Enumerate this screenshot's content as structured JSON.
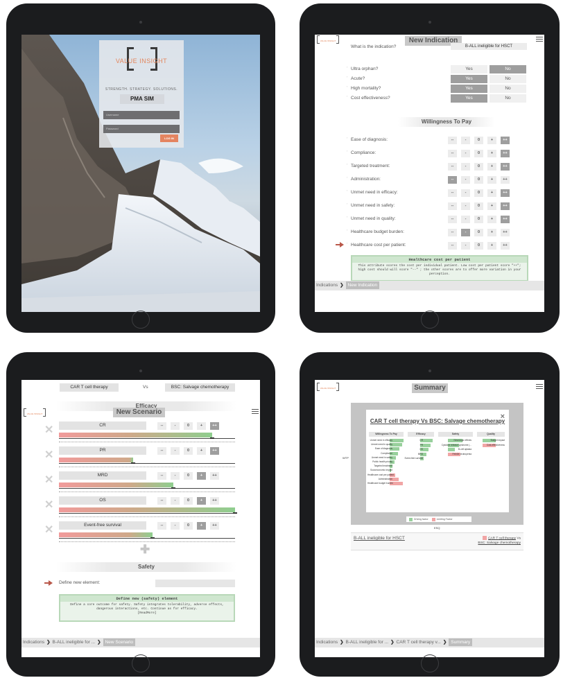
{
  "login": {
    "brand": "VALUE INSIGHT",
    "tagline": "STRENGTH. STRATEGY. SOLUTIONS.",
    "app_title": "PMA SIM",
    "username_placeholder": "Username",
    "password_placeholder": "Password",
    "login_button": "LOG IN"
  },
  "indication": {
    "header_title": "New Indication",
    "question": "What is the indication?",
    "indication_value": "B-ALL ineligible for HSCT",
    "yes_no": [
      {
        "label": "Ultra orphan?",
        "yes": "Yes",
        "no": "No",
        "selected": "No"
      },
      {
        "label": "Acute?",
        "yes": "Yes",
        "no": "No",
        "selected": "Yes"
      },
      {
        "label": "High mortality?",
        "yes": "Yes",
        "no": "No",
        "selected": "Yes"
      },
      {
        "label": "Cost effectiveness?",
        "yes": "Yes",
        "no": "No",
        "selected": "Yes"
      }
    ],
    "wtp_title": "Willingness To Pay",
    "score_options": [
      "--",
      "-",
      "0",
      "+",
      "++"
    ],
    "attributes": [
      {
        "label": "Ease of diagnosis:",
        "selected": "++"
      },
      {
        "label": "Compliance:",
        "selected": "++"
      },
      {
        "label": "Targeted treatment:",
        "selected": "++"
      },
      {
        "label": "Administration:",
        "selected": "--"
      },
      {
        "label": "Unmet need in efficacy:",
        "selected": "++"
      },
      {
        "label": "Unmet need in safety:",
        "selected": "++"
      },
      {
        "label": "Unmet need in quality:",
        "selected": "++"
      },
      {
        "label": "Healthcare budget burden:",
        "selected": "-"
      },
      {
        "label": "Healthcare cost per patient:",
        "selected": ""
      }
    ],
    "tooltip_title": "Healthcare cost per patient",
    "tooltip_body": "This attribute scores the cost per individual patient. Low cost per patient score \"++\"; high cost should will score \"--\" ; the other scores are to offer more variation in your perception.",
    "breadcrumbs": [
      "Indications",
      "New Indication"
    ]
  },
  "scenario": {
    "header_title": "New Scenario",
    "treatment": "CAR T cell therapy",
    "vs": "Vs",
    "comparator": "BSC: Salvage chemotherapy",
    "efficacy_title": "Efficacy",
    "score_options": [
      "--",
      "-",
      "0",
      "+",
      "++"
    ],
    "elements": [
      {
        "name": "CR",
        "selected": "++",
        "level": 0.87
      },
      {
        "name": "PR",
        "selected": "++",
        "level": 0.42
      },
      {
        "name": "MRD",
        "selected": "+",
        "level": 0.65
      },
      {
        "name": "OS",
        "selected": "+",
        "level": 1.0
      },
      {
        "name": "Event-free survival",
        "selected": "+",
        "level": 0.53
      }
    ],
    "safety_title": "Safety",
    "define_label": "Define new element:",
    "tooltip_title": "Define new (safety) element",
    "tooltip_body": "Define a core outcome for safety. Safety integrates tolerability, adverse effects, dangerous interactions, etc. Continue as for efficacy.",
    "tooltip_footer": "[ReadMore]",
    "breadcrumbs": [
      "Indications",
      "B-ALL ineligible for ...",
      "New Scenario"
    ]
  },
  "summary": {
    "header_title": "Summary",
    "popup_title": "CAR T cell therapy Vs BSC: Salvage chemotherapy",
    "close": "×",
    "columns": [
      "Willingness To Pay",
      "Efficacy",
      "Safety",
      "Quality"
    ],
    "wtp_items": [
      {
        "label": "Unmet need in efficacy",
        "type": "driving",
        "size": 0.9
      },
      {
        "label": "Unmet need in quality",
        "type": "driving",
        "size": 0.8
      },
      {
        "label": "Ease of diagnosis",
        "type": "driving",
        "size": 0.65
      },
      {
        "label": "Compliance",
        "type": "driving",
        "size": 0.55
      },
      {
        "label": "Unmet need in safety",
        "type": "driving",
        "size": 0.4
      },
      {
        "label": "Public health priority",
        "type": "driving",
        "size": 0.3
      },
      {
        "label": "Targeted treatment",
        "type": "driving",
        "size": 0.2
      },
      {
        "label": "Socioeconomic impact",
        "type": "driving",
        "size": 0.1
      },
      {
        "label": "Healthcare cost per patient",
        "type": "limiting",
        "size": 0.35
      },
      {
        "label": "Administration",
        "type": "limiting",
        "size": 0.6
      },
      {
        "label": "Healthcare budget burden",
        "type": "limiting",
        "size": 0.85
      }
    ],
    "efficacy_items": [
      {
        "label": "CR",
        "type": "driving",
        "size": 0.9
      },
      {
        "label": "PR",
        "type": "driving",
        "size": 0.75
      },
      {
        "label": "OS",
        "type": "driving",
        "size": 0.6
      },
      {
        "label": "MRD",
        "type": "driving",
        "size": 0.45
      },
      {
        "label": "Event-free survival",
        "type": "driving",
        "size": 0.25
      }
    ],
    "safety_items": [
      {
        "label": "Neurologic effects",
        "type": "driving",
        "size": 0.8
      },
      {
        "label": "Cytokine release syndrome (...",
        "type": "driving",
        "size": 0.6
      },
      {
        "label": "B-cell aplasia",
        "type": "driving",
        "size": 0.4
      },
      {
        "label": "Febrile neutropenia",
        "type": "limiting",
        "size": 0.7
      }
    ],
    "quality_items": [
      {
        "label": "Budget impact",
        "type": "driving",
        "size": 0.8
      },
      {
        "label": "Cost-effectiveness",
        "type": "limiting",
        "size": 0.8
      }
    ],
    "legend": {
      "driving": "Driving factor",
      "limiting": "Limiting Factor"
    },
    "y_axis": "WTP",
    "x_axis": "ESQ",
    "indication": "B-ALL ineligible for HSCT",
    "scenario_link_1": "CAR T cell therapy",
    "scenario_vs": "Vs",
    "scenario_link_2": "BSC: Salvage chemotherapy",
    "breadcrumbs": [
      "Indications",
      "B-ALL ineligible for ...",
      "CAR T cell therapy v...",
      "Summary"
    ]
  },
  "colors": {
    "driving": "#98d09c",
    "limiting": "#f1a5a5",
    "accent": "#e3855b",
    "arrow": "#b9584a"
  }
}
